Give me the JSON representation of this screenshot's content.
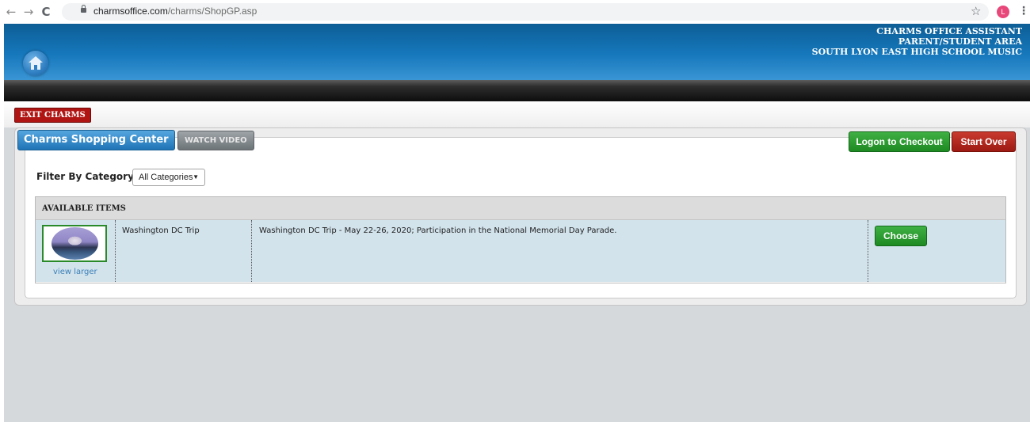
{
  "browser": {
    "url_host": "charmsoffice.com",
    "url_path": "/charms/ShopGP.asp",
    "profile_initial": "L"
  },
  "header": {
    "line1": "CHARMS OFFICE ASSISTANT",
    "line2": "PARENT/STUDENT AREA",
    "line3": "SOUTH LYON EAST HIGH SCHOOL MUSIC"
  },
  "nav": {
    "exit_label": "EXIT CHARMS"
  },
  "shop": {
    "title": "Charms Shopping Center",
    "watch_video": "WATCH VIDEO",
    "logon_checkout": "Logon to Checkout",
    "start_over": "Start Over",
    "filter_label": "Filter By Category",
    "filter_value": "All Categories",
    "items_header": "AVAILABLE ITEMS",
    "items": [
      {
        "name": "Washington DC Trip",
        "description": "Washington DC Trip - May 22-26, 2020; Participation in the National Memorial Day Parade.",
        "view_larger": "view larger",
        "choose_label": "Choose"
      }
    ]
  },
  "colors": {
    "header_blue": "#1678bc",
    "exit_red": "#b01513",
    "checkout_green": "#1d8a22",
    "start_over_red": "#9d1a12",
    "row_bg": "#d2e3ec"
  },
  "icons": [
    "back-arrow-icon",
    "forward-arrow-icon",
    "reload-icon",
    "lock-icon",
    "star-icon",
    "profile-icon",
    "menu-icon",
    "home-icon",
    "dropdown-caret-icon"
  ]
}
